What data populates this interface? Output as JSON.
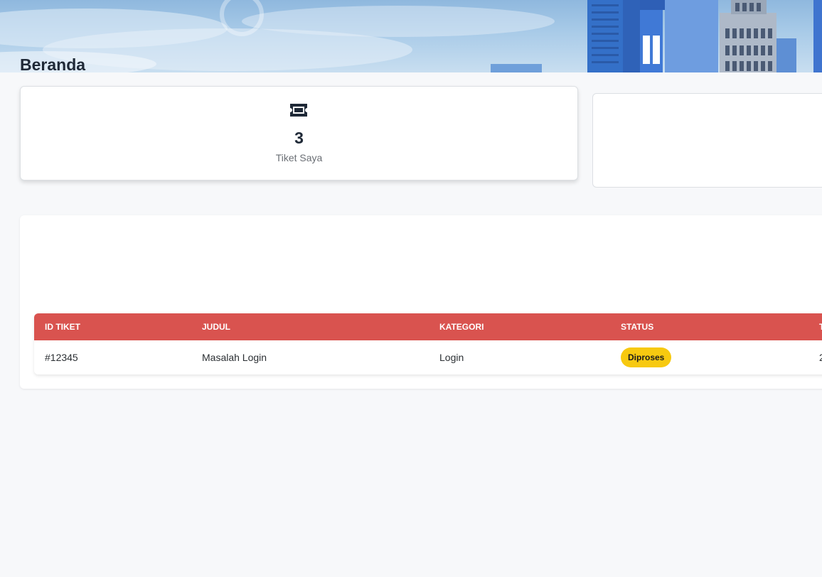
{
  "page": {
    "title": "Beranda"
  },
  "stats": [
    {
      "icon": "ticket-icon",
      "value": "3",
      "label": "Tiket Saya"
    }
  ],
  "table": {
    "header_color": "#d9534f",
    "columns": [
      "ID TIKET",
      "JUDUL",
      "KATEGORI",
      "STATUS",
      "T"
    ],
    "rows": [
      {
        "id": "#12345",
        "judul": "Masalah Login",
        "kategori": "Login",
        "status": "Diproses",
        "cut": "2"
      }
    ]
  },
  "colors": {
    "status_diproses": "#f7c910",
    "background": "#f7f8fa"
  }
}
